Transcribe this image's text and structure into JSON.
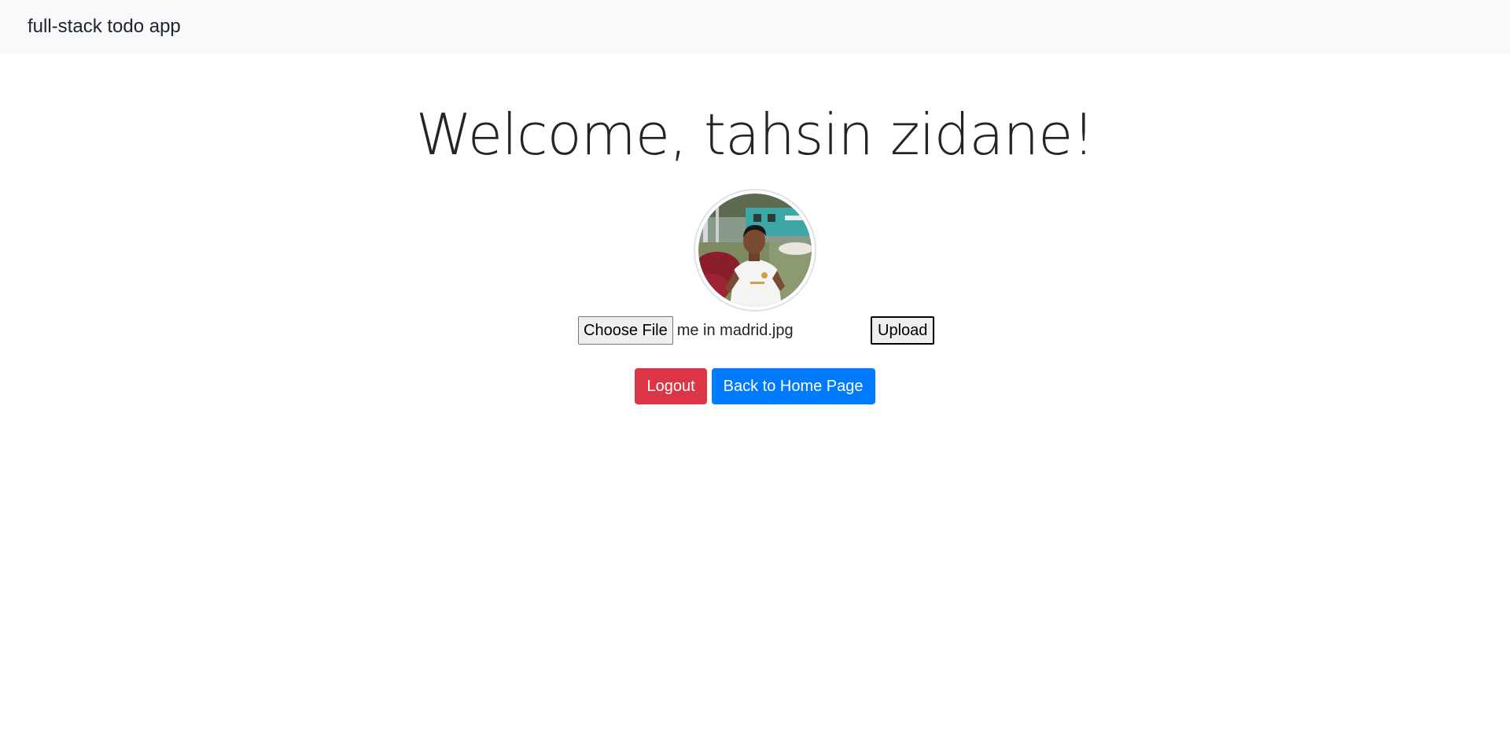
{
  "navbar": {
    "brand": "full-stack todo app"
  },
  "main": {
    "welcome": "Welcome, tahsin zidane!",
    "upload": {
      "choose_file_label": "Choose File",
      "file_name": "me in madrid.jpg",
      "upload_label": "Upload"
    },
    "actions": {
      "logout_label": "Logout",
      "home_label": "Back to Home Page"
    }
  },
  "colors": {
    "navbar_bg": "#f8f9fa",
    "danger": "#dc3545",
    "primary": "#007bff"
  }
}
